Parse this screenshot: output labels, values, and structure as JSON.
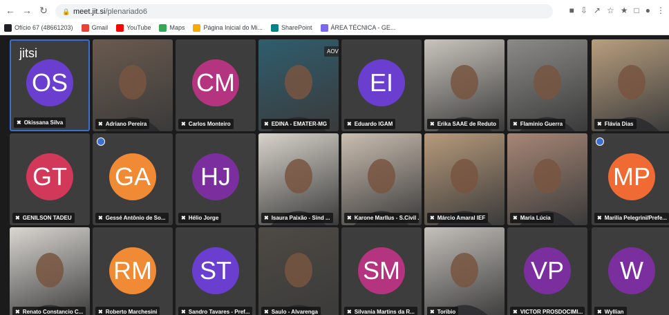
{
  "browser": {
    "url_host": "meet.jit.si",
    "url_path": "/plenariado6",
    "bookmarks": [
      {
        "label": "Ofício 67 (48661203)",
        "color": "#202124"
      },
      {
        "label": "Gmail",
        "color": "#ea4335"
      },
      {
        "label": "YouTube",
        "color": "#ff0000"
      },
      {
        "label": "Maps",
        "color": "#34a853"
      },
      {
        "label": "Página Inicial do Mi...",
        "color": "#f9ab00"
      },
      {
        "label": "SharePoint",
        "color": "#038387"
      },
      {
        "label": "ÁREA TÉCNICA - GE...",
        "color": "#7b68ee"
      }
    ]
  },
  "meeting": {
    "logo": "jitsi",
    "live_label": "AOVIVO"
  },
  "participants": [
    {
      "name": "Okissana Silva",
      "initials": "OS",
      "color": "#6a3fcf",
      "type": "avatar",
      "active": true
    },
    {
      "name": "Adriano Pereira",
      "type": "video",
      "bg": "#6a5a4e"
    },
    {
      "name": "Carlos Monteiro",
      "initials": "CM",
      "color": "#b5347f",
      "type": "avatar"
    },
    {
      "name": "EDINA - EMATER-MG",
      "type": "video",
      "bg": "#2f5d6e"
    },
    {
      "name": "Eduardo IGAM",
      "initials": "EI",
      "color": "#6a3fcf",
      "type": "avatar"
    },
    {
      "name": "Erika SAAE de Reduto",
      "type": "video",
      "bg": "#c9c4bd"
    },
    {
      "name": "Flaminio Guerra",
      "type": "video",
      "bg": "#8b8a88"
    },
    {
      "name": "Flávia Dias",
      "type": "video",
      "bg": "#b89e7e"
    },
    {
      "name": "GENILSON TADEU",
      "initials": "GT",
      "color": "#d2385a",
      "type": "avatar"
    },
    {
      "name": "Gessé Antônio de So...",
      "initials": "GA",
      "color": "#f08a34",
      "type": "avatar",
      "quality": true
    },
    {
      "name": "Hélio Jorge",
      "initials": "HJ",
      "color": "#7b2f9e",
      "type": "avatar"
    },
    {
      "name": "Isaura Paixão - Sind ...",
      "type": "video",
      "bg": "#d8d3cb"
    },
    {
      "name": "Karone Marllus - S.Civil ...",
      "type": "video",
      "bg": "#cbbeb1"
    },
    {
      "name": "Márcio Amaral IEF",
      "type": "video",
      "bg": "#b79a7b"
    },
    {
      "name": "Maria Lúcia",
      "type": "video",
      "bg": "#a78675"
    },
    {
      "name": "Marilia Pelegrini/Prefe...",
      "initials": "MP",
      "color": "#f06a34",
      "type": "avatar",
      "quality": true
    },
    {
      "name": "Renato Constancio C...",
      "type": "video",
      "bg": "#dad7d2"
    },
    {
      "name": "Roberto Marchesini",
      "initials": "RM",
      "color": "#f08a34",
      "type": "avatar"
    },
    {
      "name": "Sandro Tavares - Pref...",
      "initials": "ST",
      "color": "#6a3fcf",
      "type": "avatar"
    },
    {
      "name": "Saulo - Alvarenga",
      "type": "video",
      "bg": "#4e4a44"
    },
    {
      "name": "Silvania Martins da R...",
      "initials": "SM",
      "color": "#b5347f",
      "type": "avatar"
    },
    {
      "name": "Toribio",
      "type": "video",
      "bg": "#c4c0bb"
    },
    {
      "name": "VICTOR PROSDOCIMI...",
      "initials": "VP",
      "color": "#7b2f9e",
      "type": "avatar"
    },
    {
      "name": "Wyllian",
      "initials": "W",
      "color": "#7b2f9e",
      "type": "avatar"
    }
  ]
}
